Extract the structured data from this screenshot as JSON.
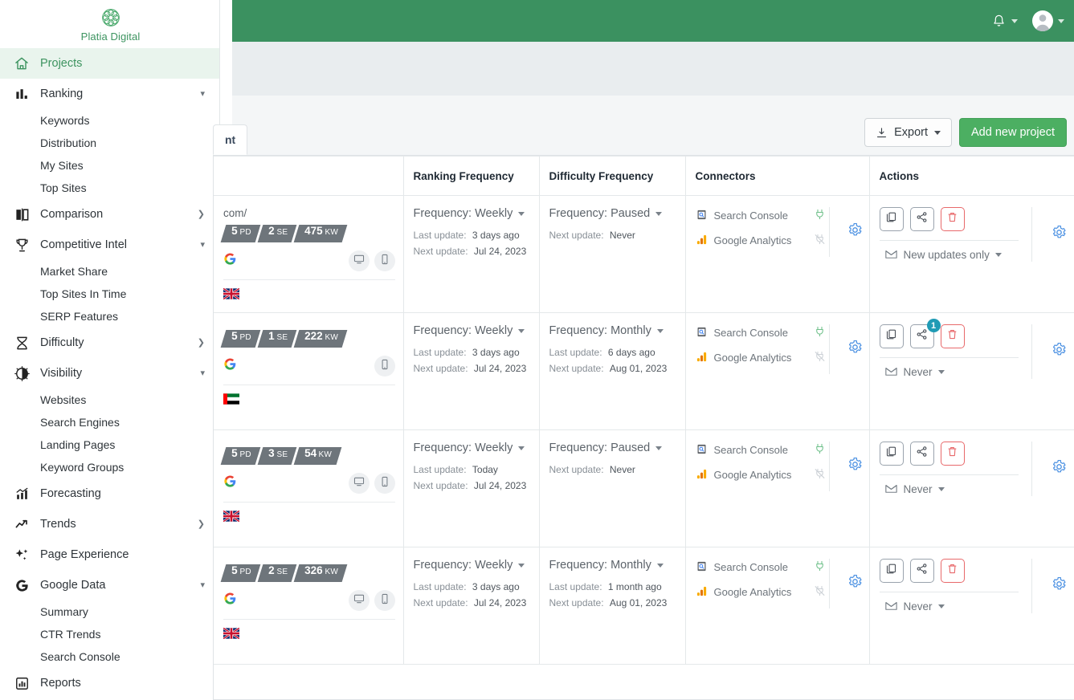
{
  "app": {
    "logo_text": "Platia Digital",
    "logo_icon": "flower-circle-logo",
    "brand_green": "#3b9160",
    "accent_green": "#4caf62",
    "accent_blue": "#4a90e2",
    "danger_red": "#e8696b",
    "badge_teal": "#1f9bb5"
  },
  "topbar": {
    "notifications_icon": "bell-icon",
    "avatar_icon": "user-avatar-icon"
  },
  "sidebar": {
    "items": [
      {
        "label": "Projects",
        "icon": "home-icon",
        "active": true,
        "caret": "",
        "children": []
      },
      {
        "label": "Ranking",
        "icon": "bar-chart-icon",
        "active": false,
        "caret": "down",
        "children": [
          "Keywords",
          "Distribution",
          "My Sites",
          "Top Sites"
        ]
      },
      {
        "label": "Comparison",
        "icon": "compare-icon",
        "active": false,
        "caret": "right",
        "children": []
      },
      {
        "label": "Competitive Intel",
        "icon": "trophy-icon",
        "active": false,
        "caret": "down",
        "children": [
          "Market Share",
          "Top Sites In Time",
          "SERP Features"
        ]
      },
      {
        "label": "Difficulty",
        "icon": "hourglass-icon",
        "active": false,
        "caret": "right",
        "children": []
      },
      {
        "label": "Visibility",
        "icon": "brightness-icon",
        "active": false,
        "caret": "down",
        "children": [
          "Websites",
          "Search Engines",
          "Landing Pages",
          "Keyword Groups"
        ]
      },
      {
        "label": "Forecasting",
        "icon": "forecast-chart-icon",
        "active": false,
        "caret": "",
        "children": []
      },
      {
        "label": "Trends",
        "icon": "trend-arrow-icon",
        "active": false,
        "caret": "right",
        "children": []
      },
      {
        "label": "Page Experience",
        "icon": "sparkle-icon",
        "active": false,
        "caret": "",
        "children": []
      },
      {
        "label": "Google Data",
        "icon": "google-g-icon",
        "active": false,
        "caret": "down",
        "children": [
          "Summary",
          "CTR Trends",
          "Search Console"
        ]
      },
      {
        "label": "Reports",
        "icon": "report-icon",
        "active": false,
        "caret": "",
        "children": []
      }
    ]
  },
  "toolbar": {
    "tab_label": "nt",
    "export_label": "Export",
    "export_icon": "download-icon",
    "add_project_label": "Add new project"
  },
  "table": {
    "headers": [
      "",
      "Ranking Frequency",
      "Difficulty Frequency",
      "Connectors",
      "Actions"
    ],
    "rows": [
      {
        "project": {
          "url": "com/",
          "badges": [
            {
              "num": "5",
              "unit": "PD"
            },
            {
              "num": "2",
              "unit": "SE"
            },
            {
              "num": "475",
              "unit": "KW"
            }
          ],
          "engine_icon": "google-g-icon",
          "devices": [
            "desktop-icon",
            "mobile-icon"
          ],
          "flag": "uk"
        },
        "ranking": {
          "frequency_label": "Frequency: Weekly",
          "last_update_label": "Last update:",
          "last_update_value": "3 days ago",
          "next_update_label": "Next update:",
          "next_update_value": "Jul 24, 2023"
        },
        "difficulty": {
          "frequency_label": "Frequency: Paused",
          "last_update_label": "",
          "last_update_value": "",
          "next_update_label": "Next update:",
          "next_update_value": "Never"
        },
        "connectors": [
          {
            "name": "Search Console",
            "icon": "search-console-icon",
            "status": "connected"
          },
          {
            "name": "Google Analytics",
            "icon": "google-analytics-icon",
            "status": "disconnected"
          }
        ],
        "actions": {
          "share_badge": "",
          "notify_label": "New updates only"
        }
      },
      {
        "project": {
          "url": "",
          "badges": [
            {
              "num": "5",
              "unit": "PD"
            },
            {
              "num": "1",
              "unit": "SE"
            },
            {
              "num": "222",
              "unit": "KW"
            }
          ],
          "engine_icon": "google-g-icon",
          "devices": [
            "mobile-icon"
          ],
          "flag": "ae"
        },
        "ranking": {
          "frequency_label": "Frequency: Weekly",
          "last_update_label": "Last update:",
          "last_update_value": "3 days ago",
          "next_update_label": "Next update:",
          "next_update_value": "Jul 24, 2023"
        },
        "difficulty": {
          "frequency_label": "Frequency: Monthly",
          "last_update_label": "Last update:",
          "last_update_value": "6 days ago",
          "next_update_label": "Next update:",
          "next_update_value": "Aug 01, 2023"
        },
        "connectors": [
          {
            "name": "Search Console",
            "icon": "search-console-icon",
            "status": "connected"
          },
          {
            "name": "Google Analytics",
            "icon": "google-analytics-icon",
            "status": "disconnected"
          }
        ],
        "actions": {
          "share_badge": "1",
          "notify_label": "Never"
        }
      },
      {
        "project": {
          "url": "",
          "badges": [
            {
              "num": "5",
              "unit": "PD"
            },
            {
              "num": "3",
              "unit": "SE"
            },
            {
              "num": "54",
              "unit": "KW"
            }
          ],
          "engine_icon": "google-g-icon",
          "devices": [
            "desktop-icon",
            "mobile-icon"
          ],
          "flag": "uk"
        },
        "ranking": {
          "frequency_label": "Frequency: Weekly",
          "last_update_label": "Last update:",
          "last_update_value": "Today",
          "next_update_label": "Next update:",
          "next_update_value": "Jul 24, 2023"
        },
        "difficulty": {
          "frequency_label": "Frequency: Paused",
          "last_update_label": "",
          "last_update_value": "",
          "next_update_label": "Next update:",
          "next_update_value": "Never"
        },
        "connectors": [
          {
            "name": "Search Console",
            "icon": "search-console-icon",
            "status": "connected"
          },
          {
            "name": "Google Analytics",
            "icon": "google-analytics-icon",
            "status": "disconnected"
          }
        ],
        "actions": {
          "share_badge": "",
          "notify_label": "Never"
        }
      },
      {
        "project": {
          "url": "",
          "badges": [
            {
              "num": "5",
              "unit": "PD"
            },
            {
              "num": "2",
              "unit": "SE"
            },
            {
              "num": "326",
              "unit": "KW"
            }
          ],
          "engine_icon": "google-g-icon",
          "devices": [
            "desktop-icon",
            "mobile-icon"
          ],
          "flag": "uk"
        },
        "ranking": {
          "frequency_label": "Frequency: Weekly",
          "last_update_label": "Last update:",
          "last_update_value": "3 days ago",
          "next_update_label": "Next update:",
          "next_update_value": "Jul 24, 2023"
        },
        "difficulty": {
          "frequency_label": "Frequency: Monthly",
          "last_update_label": "Last update:",
          "last_update_value": "1 month ago",
          "next_update_label": "Next update:",
          "next_update_value": "Aug 01, 2023"
        },
        "connectors": [
          {
            "name": "Search Console",
            "icon": "search-console-icon",
            "status": "connected"
          },
          {
            "name": "Google Analytics",
            "icon": "google-analytics-icon",
            "status": "disconnected"
          }
        ],
        "actions": {
          "share_badge": "",
          "notify_label": "Never"
        }
      }
    ]
  }
}
